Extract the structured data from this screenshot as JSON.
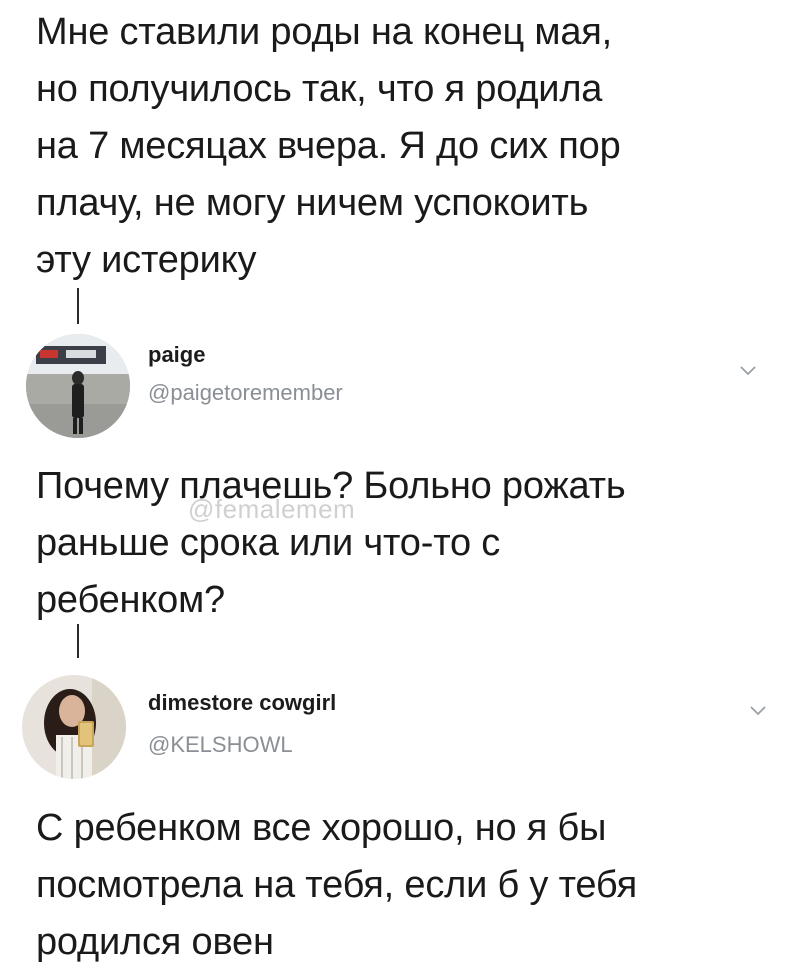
{
  "tweets": [
    {
      "text": "Мне ставили роды на конец мая,\nно получилось так, что я родила\nна 7 месяцах вчера. Я до сих пор\nплачу, не могу ничем успокоить\nэту истерику"
    },
    {
      "author": {
        "name": "paige",
        "handle": "@paigetoremember",
        "avatar_icon": "avatar-photo-icon"
      },
      "text": "Почему плачешь? Больно рожать\nраньше срока или что-то с\nребенком?"
    },
    {
      "author": {
        "name": "dimestore cowgirl",
        "handle": "@KELSHOWL",
        "avatar_icon": "avatar-photo-icon"
      },
      "text": "С ребенком все хорошо, но я бы\nпосмотрела на тебя, если б у тебя\nродился овен"
    }
  ],
  "watermark": "@femalemem",
  "colors": {
    "text": "#1a1a1a",
    "handle": "#8a8f96",
    "chevron": "#9aa0a6"
  }
}
